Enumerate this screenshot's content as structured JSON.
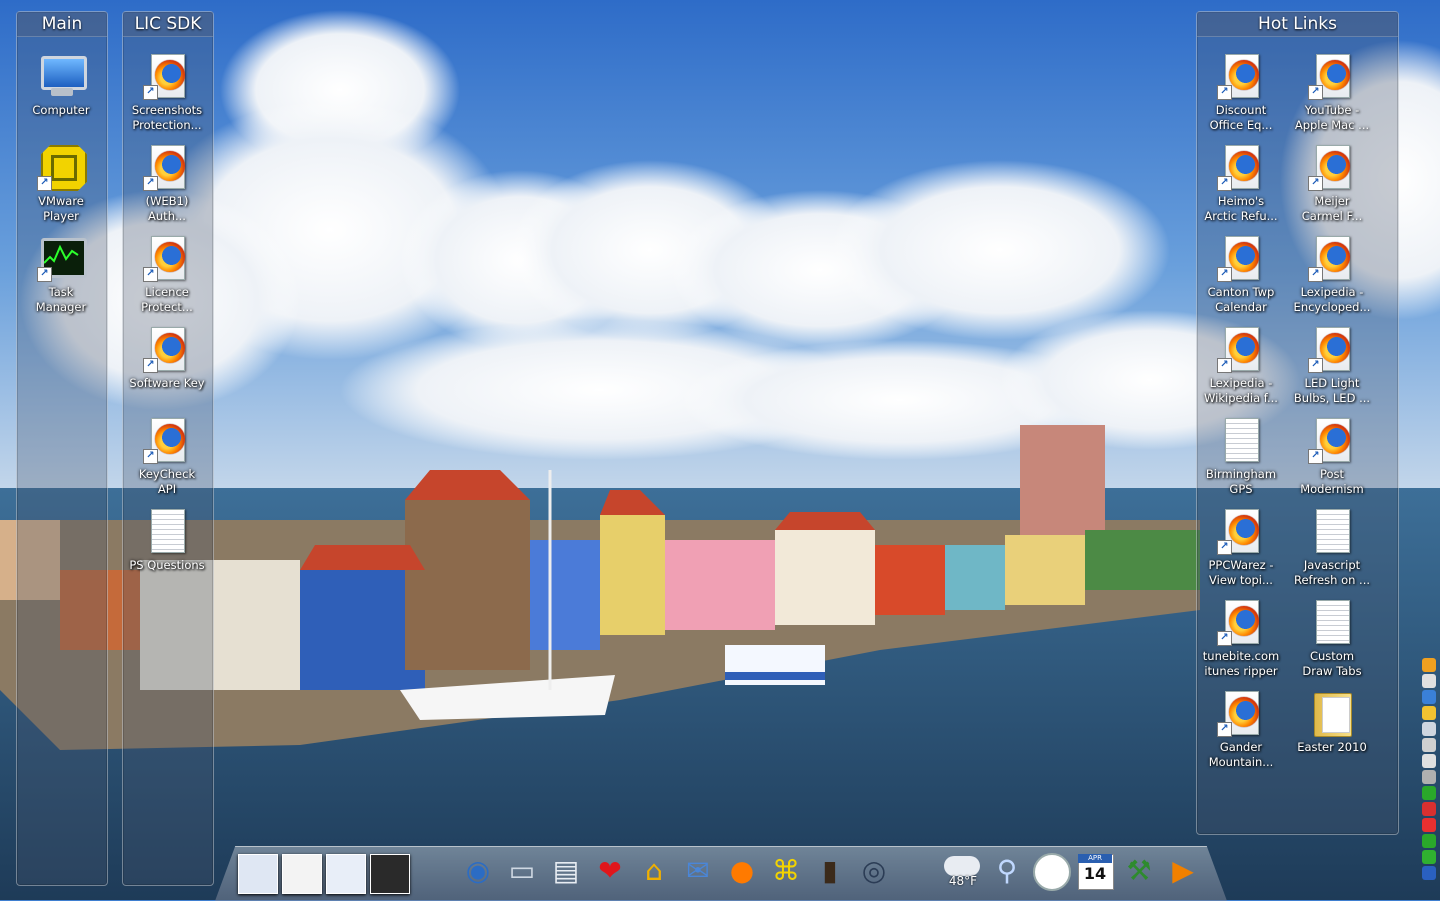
{
  "fences": {
    "main": {
      "title": "Main",
      "icons": [
        {
          "label": "Computer",
          "icon": "computer-icon"
        },
        {
          "label": "VMware\nPlayer",
          "icon": "vmware-icon"
        },
        {
          "label": "Task\nManager",
          "icon": "task-manager-icon"
        }
      ]
    },
    "lic_sdk": {
      "title": "LIC SDK",
      "icons": [
        {
          "label": "Screenshots\nProtection...",
          "icon": "firefox-shortcut-icon"
        },
        {
          "label": "(WEB1)\nAuth...",
          "icon": "firefox-shortcut-icon"
        },
        {
          "label": "Licence\nProtect...",
          "icon": "firefox-shortcut-icon"
        },
        {
          "label": "Software Key",
          "icon": "firefox-shortcut-icon"
        },
        {
          "label": "KeyCheck\nAPI",
          "icon": "firefox-shortcut-icon"
        },
        {
          "label": "PS Questions",
          "icon": "document-icon"
        }
      ]
    },
    "hot_links": {
      "title": "Hot Links",
      "icons": [
        {
          "label": "Discount\nOffice Eq...",
          "icon": "firefox-shortcut-icon"
        },
        {
          "label": "YouTube -\nApple Mac ...",
          "icon": "firefox-shortcut-icon"
        },
        {
          "label": "Heimo's\nArctic Refu...",
          "icon": "firefox-shortcut-icon"
        },
        {
          "label": "Meijer\nCarmel F...",
          "icon": "firefox-shortcut-icon"
        },
        {
          "label": "Canton Twp\nCalendar",
          "icon": "firefox-shortcut-icon"
        },
        {
          "label": "Lexipedia -\nEncycloped...",
          "icon": "firefox-shortcut-icon"
        },
        {
          "label": "Lexipedia -\nWikipedia f...",
          "icon": "firefox-shortcut-icon"
        },
        {
          "label": "LED Light\nBulbs, LED ...",
          "icon": "firefox-shortcut-icon"
        },
        {
          "label": "Birmingham\nGPS",
          "icon": "text-document-icon"
        },
        {
          "label": "Post\nModernism",
          "icon": "firefox-shortcut-icon"
        },
        {
          "label": "PPCWarez -\nView topi...",
          "icon": "firefox-shortcut-icon"
        },
        {
          "label": "Javascript\nRefresh on ...",
          "icon": "document-icon"
        },
        {
          "label": "tunebite.com\nitunes ripper",
          "icon": "firefox-shortcut-icon"
        },
        {
          "label": "Custom\nDraw Tabs",
          "icon": "document-icon"
        },
        {
          "label": "Gander\nMountain...",
          "icon": "firefox-shortcut-icon"
        },
        {
          "label": "Easter 2010",
          "icon": "folder-icon"
        }
      ]
    }
  },
  "dock": {
    "weather_temp": "48°F",
    "calendar_month": "APR",
    "calendar_day": "14",
    "items": [
      {
        "name": "start-orb-icon",
        "glyph": "◉",
        "color": "#2b6cc4"
      },
      {
        "name": "laptop-icon",
        "glyph": "💻",
        "color": "#cfd8e3"
      },
      {
        "name": "documents-icon",
        "glyph": "▤",
        "color": "#e8edf3"
      },
      {
        "name": "heart-icon",
        "glyph": "❤",
        "color": "#e0161b"
      },
      {
        "name": "lock-home-icon",
        "glyph": "⌂",
        "color": "#f0b000"
      },
      {
        "name": "mail-icon",
        "glyph": "✉",
        "color": "#4a86d8"
      },
      {
        "name": "firefox-icon",
        "glyph": "●",
        "color": "#ff7a00"
      },
      {
        "name": "vmware-icon",
        "glyph": "⌘",
        "color": "#f2d300"
      },
      {
        "name": "book-icon",
        "glyph": "▮",
        "color": "#3b2a1a"
      },
      {
        "name": "photo-viewer-icon",
        "glyph": "◎",
        "color": "#2b3c55"
      },
      {
        "name": "magnifier-icon",
        "glyph": "⚲",
        "color": "#c0d8ff"
      },
      {
        "name": "clock-icon",
        "glyph": "◷",
        "color": "#ffffff"
      },
      {
        "name": "calendar-icon",
        "glyph": "14",
        "color": "#ffffff"
      },
      {
        "name": "hammer-icon",
        "glyph": "⚒",
        "color": "#2e8b2e"
      },
      {
        "name": "media-player-icon",
        "glyph": "▶",
        "color": "#f08000"
      }
    ]
  },
  "colors": {
    "sky_top": "#2e6cc8",
    "sky_bottom": "#9cc0e8",
    "water": "#2a4d6e",
    "fence_bg": "rgba(70,82,105,0.30)"
  }
}
